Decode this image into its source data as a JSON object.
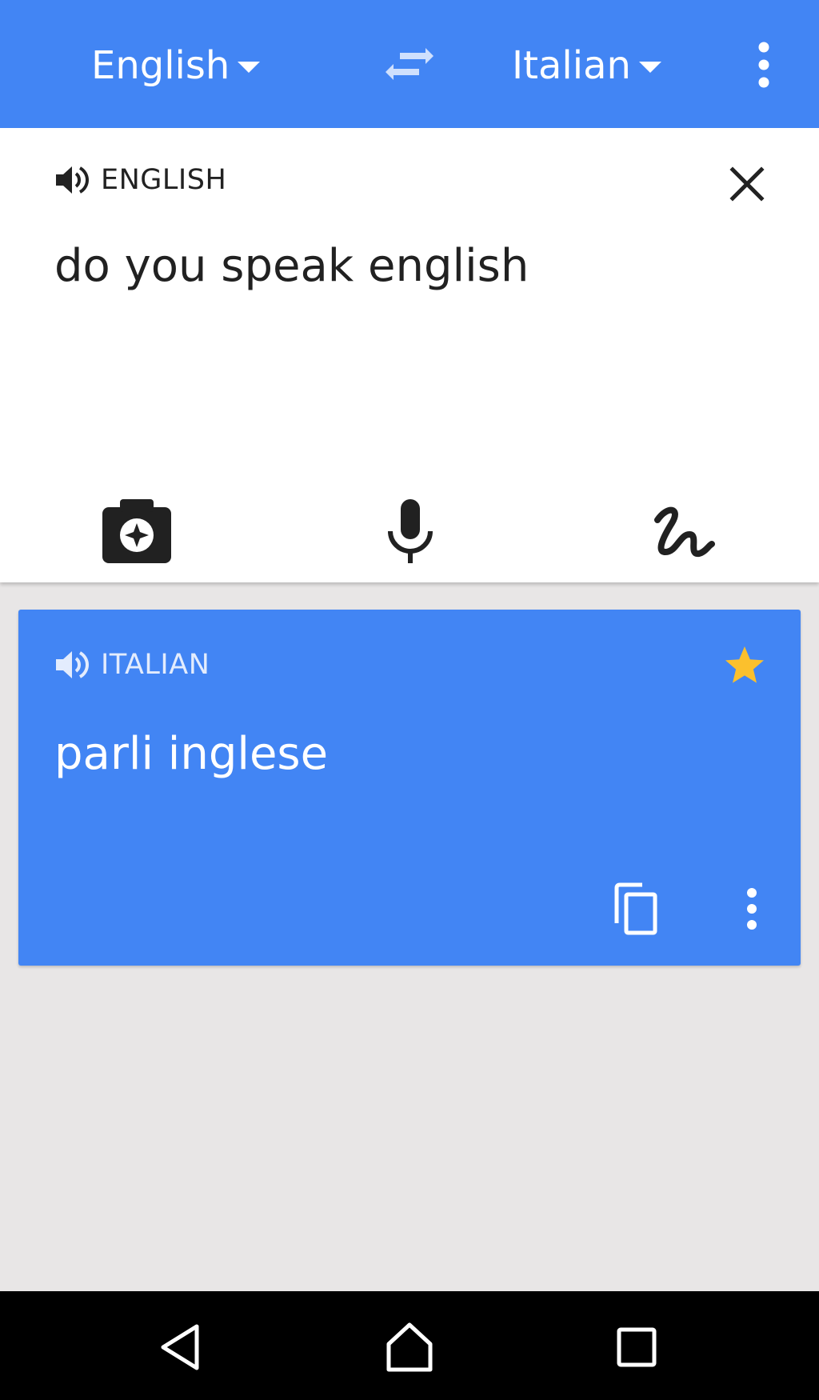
{
  "toolbar": {
    "source_language": "English",
    "target_language": "Italian",
    "icons": {
      "swap": "swap-languages-icon",
      "overflow": "more-vert-icon"
    }
  },
  "input": {
    "language_label": "ENGLISH",
    "text": "do you speak english",
    "tools": [
      "camera-icon",
      "microphone-icon",
      "handwriting-icon"
    ]
  },
  "result": {
    "language_label": "ITALIAN",
    "text": "parli inglese",
    "icons": [
      "speaker-icon",
      "star-icon",
      "copy-icon",
      "more-vert-icon"
    ]
  },
  "navigation": {
    "buttons": [
      "back-icon",
      "home-icon",
      "recents-icon"
    ]
  },
  "colors": {
    "primary": "#4285f4",
    "star": "#fbc02d",
    "background": "#e8e6e6",
    "navbar": "#000000"
  }
}
